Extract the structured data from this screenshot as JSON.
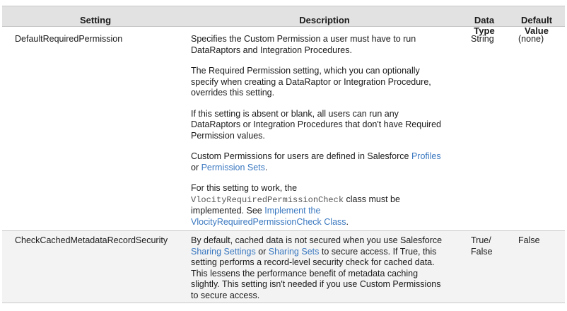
{
  "columns": {
    "setting": "Setting",
    "description": "Description",
    "data_type": [
      "Data",
      "Type"
    ],
    "default_value": [
      "Default",
      "Value"
    ]
  },
  "rows": [
    {
      "setting": "DefaultRequiredPermission",
      "data_type": "String",
      "default_value": "(none)",
      "paragraphs": [
        {
          "lines": [
            "Specifies the Custom Permission a user must have to run",
            "DataRaptors and Integration Procedures."
          ]
        },
        {
          "lines": [
            "The Required Permission setting, which you can optionally",
            "specify when creating a DataRaptor or Integration Procedure,",
            "overrides this setting."
          ]
        },
        {
          "lines": [
            "If this setting is absent or blank, all users can run any",
            "DataRaptors or Integration Procedures that don't have Required",
            "Permission values."
          ]
        },
        {
          "line1_text": "Custom Permissions for users are defined in Salesforce ",
          "line1_link": "Profiles",
          "line2_prefix": "or ",
          "line2_link": "Permission Sets",
          "line2_suffix": "."
        },
        {
          "line1": "For this setting to work, the",
          "code": "VlocityRequiredPermissionCheck",
          "code_suffix": " class must be",
          "line3_text": "implemented. See ",
          "line3_link": "Implement the",
          "line4_link": "VlocityRequiredPermissionCheck Class",
          "line4_suffix": "."
        }
      ]
    },
    {
      "setting": "CheckCachedMetadataRecordSecurity",
      "data_type": [
        "True/",
        "False"
      ],
      "default_value": "False",
      "desc": {
        "line1": "By default, cached data is not secured when you use Salesforce",
        "link_a": "Sharing Settings",
        "mid_a": " or ",
        "link_b": "Sharing Sets",
        "mid_b": " to secure access. If True, this",
        "line3": "setting performs a record-level security check for cached data.",
        "line4": "This lessens the performance benefit of metadata caching",
        "line5": "slightly. This setting isn't needed if you use Custom Permissions",
        "line6": "to secure access."
      }
    }
  ],
  "colors": {
    "header_bg": "#e2e2e2",
    "alt_row_bg": "#f3f3f3",
    "link": "#3a78c0",
    "border": "#c8c8c8"
  }
}
